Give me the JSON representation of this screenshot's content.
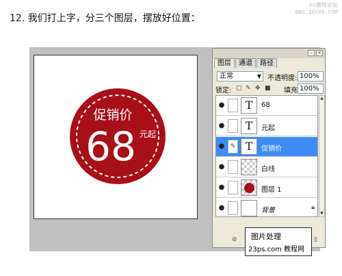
{
  "heading": "12. 我们打上字，分三个图层，摆放好位置：",
  "watermark": {
    "line1": "PS教程论坛",
    "line2": "BBS.16XX8.COM"
  },
  "badge": {
    "title": "促销价",
    "price": "68",
    "suffix": "元起",
    "color": "#a90f18"
  },
  "panel": {
    "tabs": [
      {
        "label": "图层"
      },
      {
        "label": "通道"
      },
      {
        "label": "路径"
      }
    ],
    "blend_mode": "正常",
    "opacity_label": "不透明度:",
    "opacity_value": "100%",
    "lock_label": "锁定:",
    "fill_label": "填充:",
    "fill_value": "100%",
    "layers": [
      {
        "name": "68",
        "thumb": "T"
      },
      {
        "name": "元起",
        "thumb": "T"
      },
      {
        "name": "促销价",
        "thumb": "T",
        "selected": true
      },
      {
        "name": "白线",
        "thumb": ""
      },
      {
        "name": "图层 1",
        "thumb": ""
      },
      {
        "name": "背景",
        "thumb": ""
      }
    ]
  },
  "overlay": {
    "line1": "图片处理",
    "line2": "23ps.com 教程网"
  }
}
